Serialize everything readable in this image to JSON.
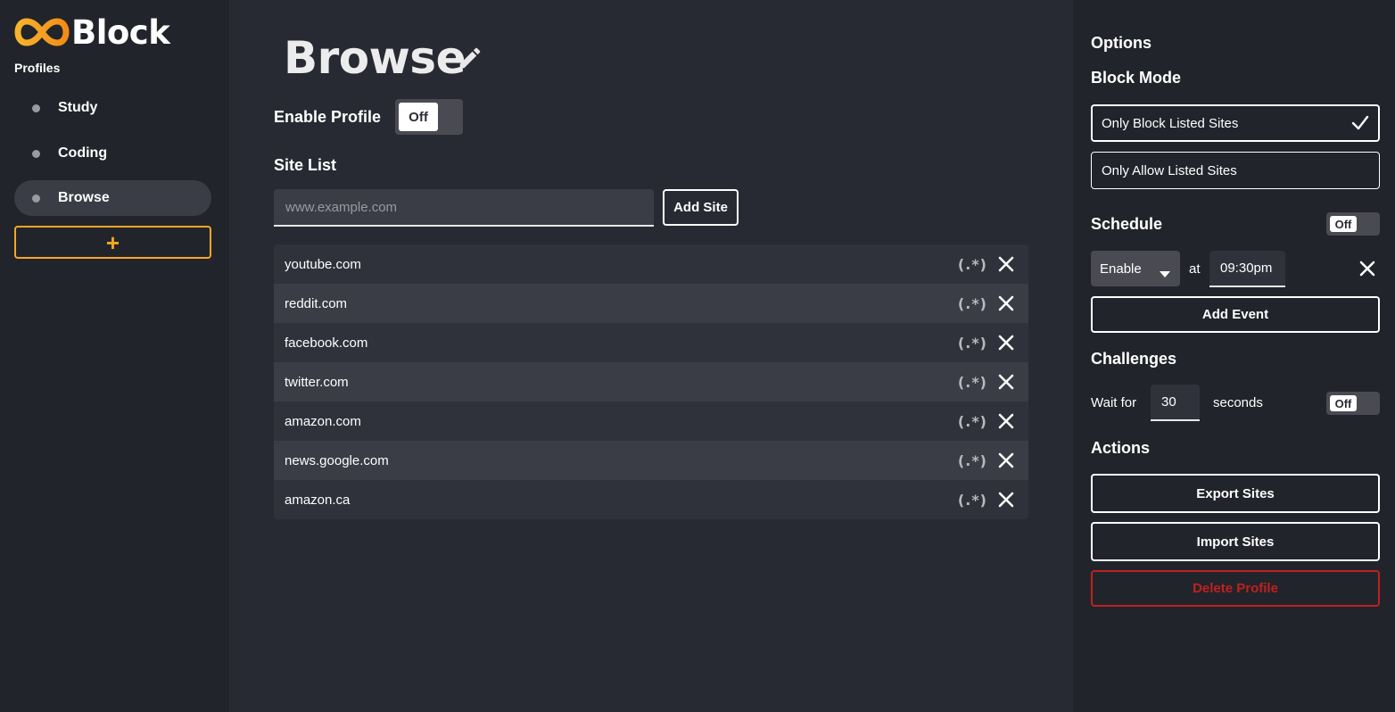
{
  "app": {
    "name": "Block"
  },
  "sidebar": {
    "heading": "Profiles",
    "items": [
      {
        "label": "Study"
      },
      {
        "label": "Coding"
      },
      {
        "label": "Browse"
      }
    ],
    "active_index": 2,
    "add_label": "+"
  },
  "main": {
    "title": "Browse",
    "enable_label": "Enable Profile",
    "enable_toggle": "Off",
    "site_list_label": "Site List",
    "site_input_placeholder": "www.example.com",
    "site_input_value": "",
    "add_site_label": "Add Site",
    "regex_label": "(.*)",
    "sites": [
      {
        "name": "youtube.com"
      },
      {
        "name": "reddit.com"
      },
      {
        "name": "facebook.com"
      },
      {
        "name": "twitter.com"
      },
      {
        "name": "amazon.com"
      },
      {
        "name": "news.google.com"
      },
      {
        "name": "amazon.ca"
      }
    ]
  },
  "options": {
    "heading": "Options",
    "block_mode": {
      "heading": "Block Mode",
      "option_block": "Only Block Listed Sites",
      "option_allow": "Only Allow Listed Sites",
      "selected": "Only Block Listed Sites"
    },
    "schedule": {
      "heading": "Schedule",
      "toggle": "Off",
      "event_action": "Enable",
      "at_label": "at",
      "event_time": "09:30pm",
      "add_event_label": "Add Event"
    },
    "challenges": {
      "heading": "Challenges",
      "wait_label": "Wait for",
      "wait_value": "30",
      "seconds_label": "seconds",
      "toggle": "Off"
    },
    "actions": {
      "heading": "Actions",
      "export_label": "Export Sites",
      "import_label": "Import Sites",
      "delete_label": "Delete Profile"
    }
  },
  "colors": {
    "background": "#282a33",
    "panel": "#22242b",
    "accent": "#f5a623",
    "danger": "#c0201f"
  }
}
